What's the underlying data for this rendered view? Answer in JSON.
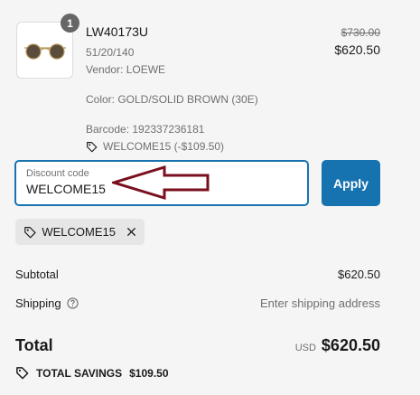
{
  "product": {
    "quantity": "1",
    "name": "LW40173U",
    "size": "51/20/140",
    "vendor": "Vendor: LOEWE",
    "color": "Color: GOLD/SOLID BROWN (30E)",
    "barcode": "Barcode: 192337236181",
    "discount_line": "WELCOME15 (-$109.50)",
    "compare_price": "$730.00",
    "price": "$620.50"
  },
  "discount": {
    "label": "Discount code",
    "value": "WELCOME15",
    "apply_label": "Apply",
    "applied_code": "WELCOME15"
  },
  "summary": {
    "subtotal_label": "Subtotal",
    "subtotal_value": "$620.50",
    "shipping_label": "Shipping",
    "shipping_value": "Enter shipping address",
    "total_label": "Total",
    "currency": "USD",
    "total_value": "$620.50",
    "savings_label": "TOTAL SAVINGS",
    "savings_value": "$109.50"
  },
  "colors": {
    "accent": "#1773b0",
    "arrow": "#7a0f1e",
    "background": "#f5f5f5"
  }
}
